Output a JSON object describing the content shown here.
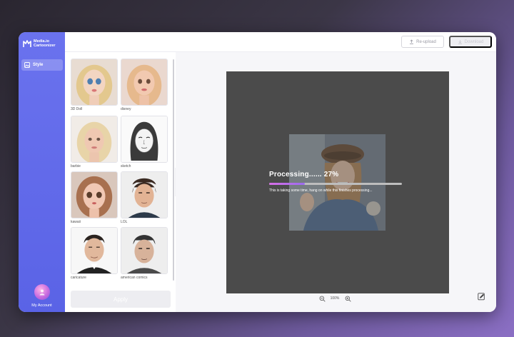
{
  "app": {
    "logo_line1": "Media.io",
    "logo_line2": "Cartoonizer",
    "brand_color": "#5a63e6"
  },
  "sidebar": {
    "items": [
      {
        "label": "Style",
        "icon": "image-icon"
      }
    ],
    "account_label": "My Account"
  },
  "toolbar": {
    "reupload_label": "Re-upload",
    "download_label": "Download"
  },
  "styles": {
    "items": [
      {
        "label": "3D Doll"
      },
      {
        "label": "disney"
      },
      {
        "label": "barbie"
      },
      {
        "label": "sketch"
      },
      {
        "label": "kawaii"
      },
      {
        "label": "LOL"
      },
      {
        "label": "caricature"
      },
      {
        "label": "american comics"
      }
    ],
    "apply_label": "Apply"
  },
  "processing": {
    "title": "Processing...... 27%",
    "progress": 0.27,
    "message": "This is taking some time, hang on while this finishes processing..."
  },
  "zoom": {
    "value": "100%"
  }
}
